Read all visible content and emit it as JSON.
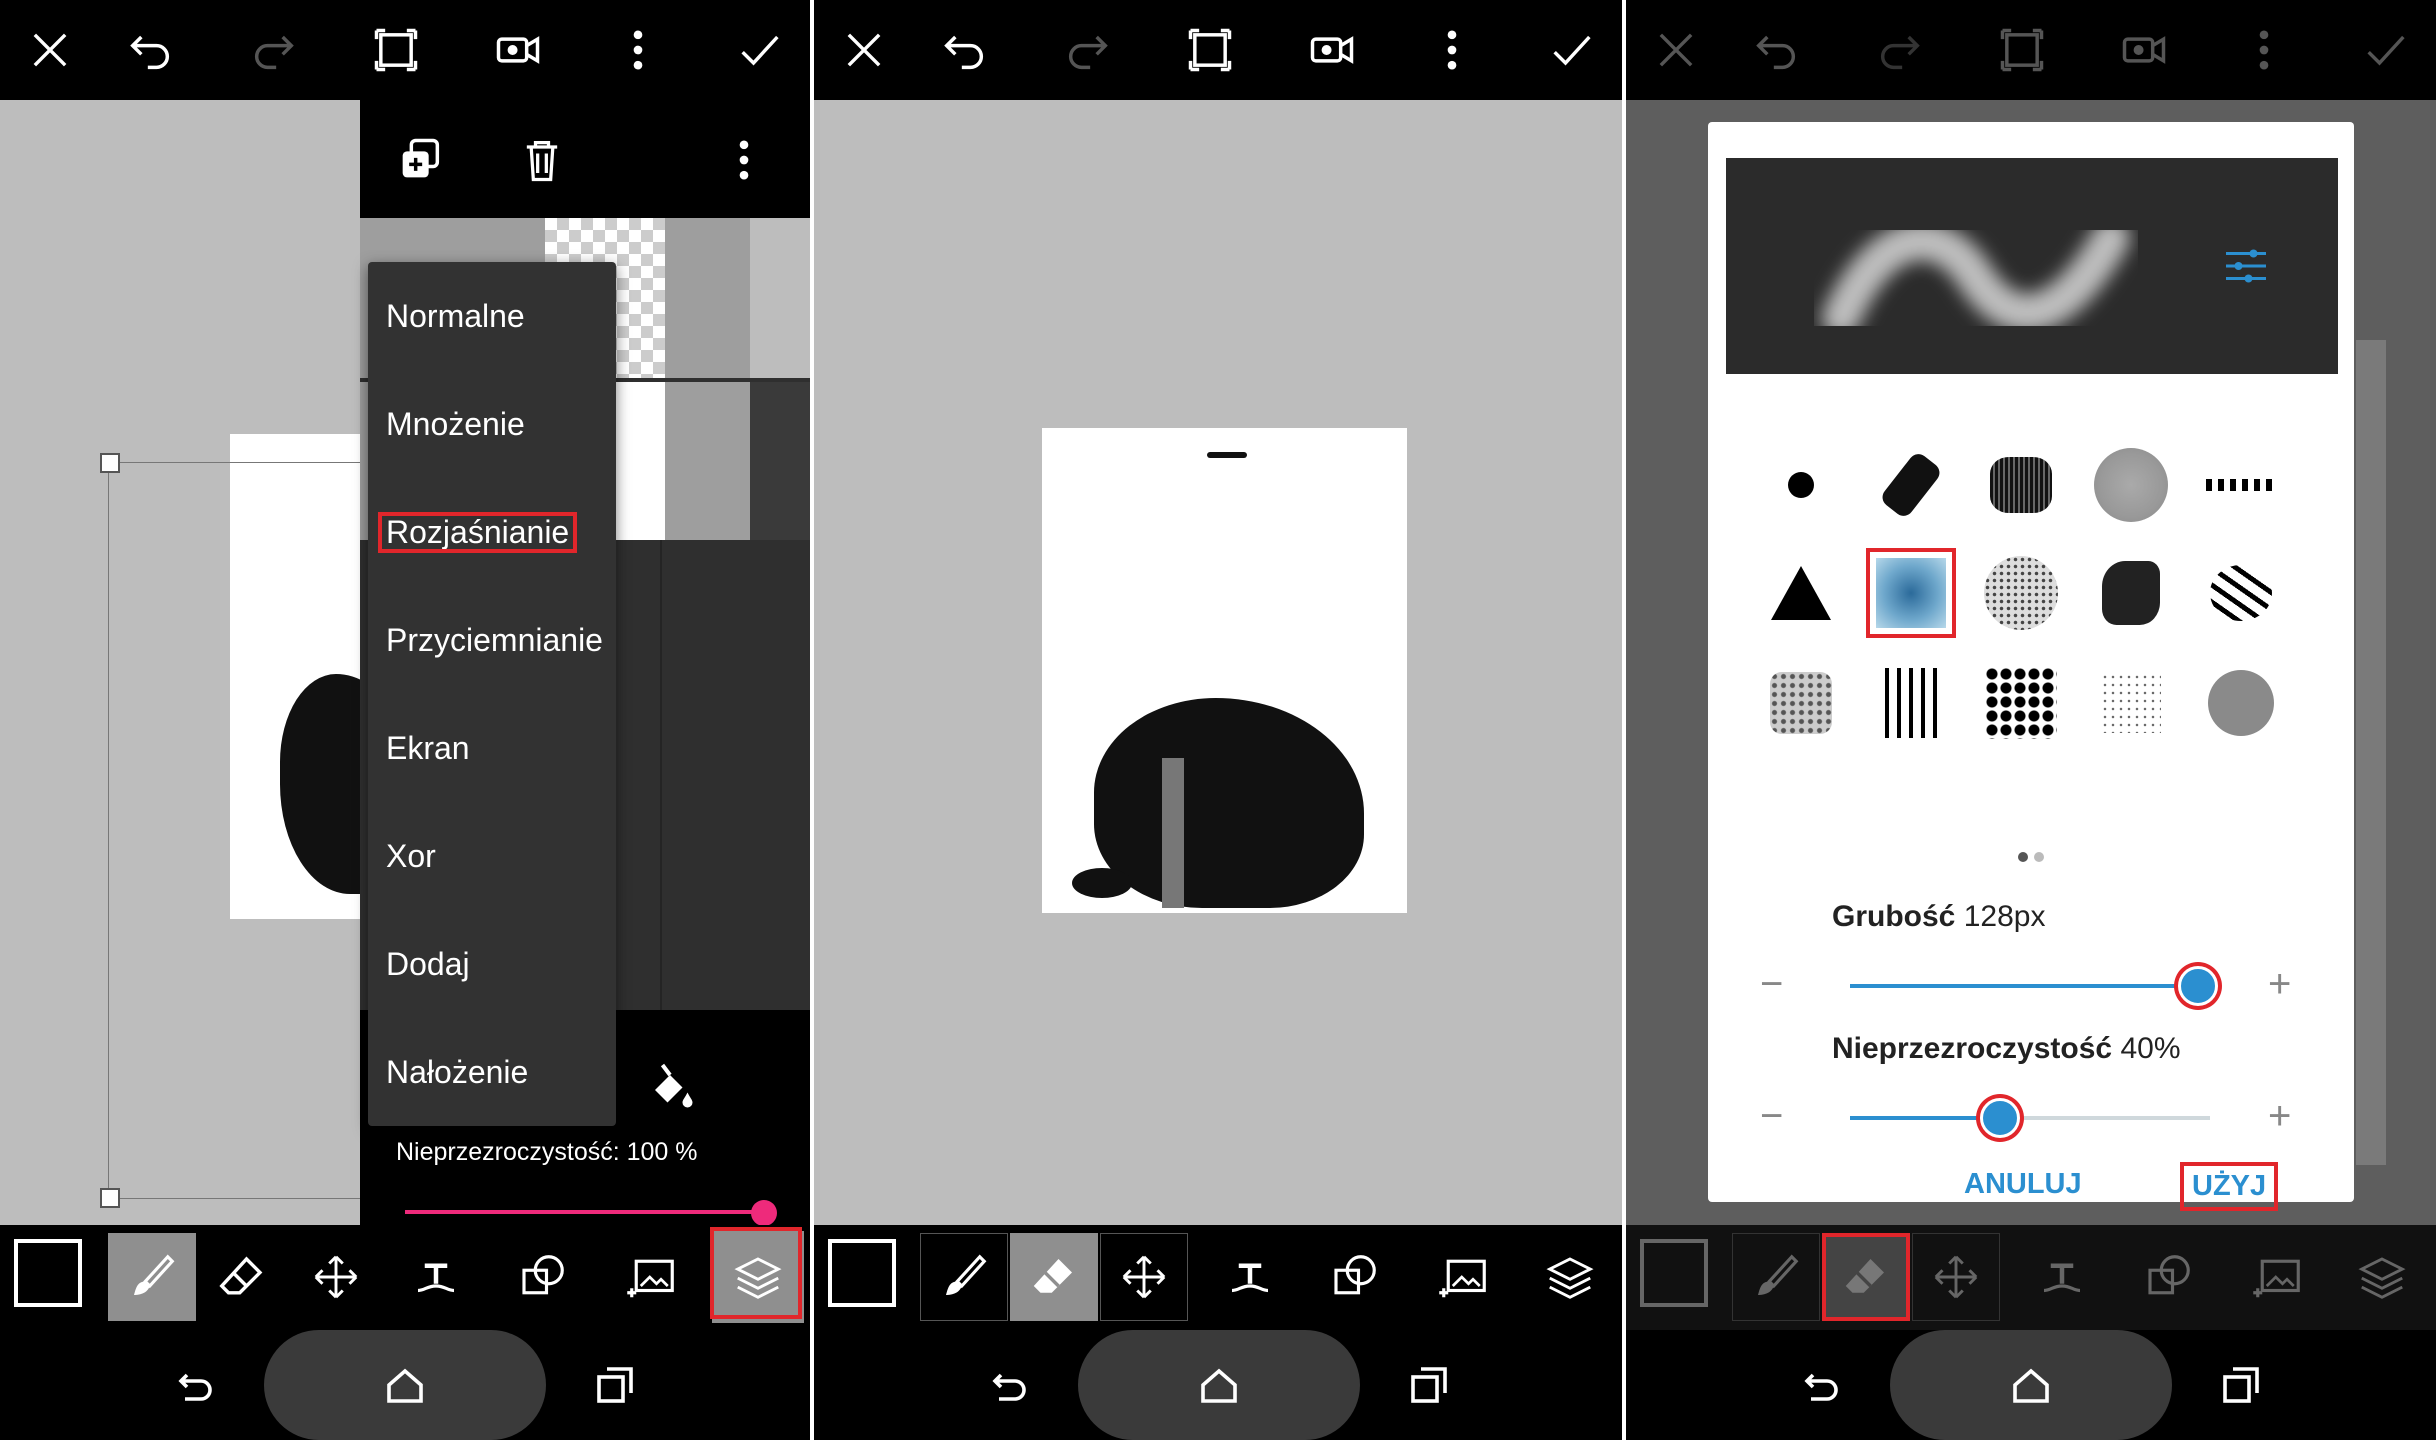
{
  "colors": {
    "accent_pink": "#ee2a7b",
    "accent_blue": "#2b8fd0",
    "highlight_red": "#e1262b"
  },
  "top_bar_icons": [
    "close-icon",
    "undo-icon",
    "redo-icon",
    "crop-frame-icon",
    "video-record-icon",
    "more-vert-icon",
    "check-icon"
  ],
  "bottom_tools": [
    "color-swatch",
    "brush-icon",
    "eraser-icon",
    "move-icon",
    "text-icon",
    "shape-icon",
    "image-add-icon",
    "layers-icon"
  ],
  "nav_icons": [
    "back-icon",
    "home-icon",
    "recent-apps-icon"
  ],
  "panel1": {
    "layer_toolbar_icons": [
      "duplicate-layer-icon",
      "delete-icon",
      "more-vert-icon"
    ],
    "blend_menu": {
      "items": [
        "Normalne",
        "Mnożenie",
        "Rozjaśnianie",
        "Przyciemnianie",
        "Ekran",
        "Xor",
        "Dodaj",
        "Nałożenie"
      ],
      "selected": "Rozjaśnianie"
    },
    "opacity_label": "Nieprzezroczystość: 100 %",
    "opacity_value": 100,
    "active_tool": "layers"
  },
  "panel2": {
    "active_tool": "eraser"
  },
  "panel3": {
    "brush_dialog": {
      "pager_pages": 2,
      "pager_current": 1,
      "selected_brush_index": 6,
      "thickness_label": "Grubość",
      "thickness_value": "128px",
      "thickness_level": 0.96,
      "opacity_label": "Nieprzezroczystość",
      "opacity_value": "40%",
      "opacity_level": 0.41,
      "minus": "−",
      "plus": "+",
      "cancel_label": "ANULUJ",
      "apply_label": "UŻYJ"
    },
    "active_tool": "eraser"
  }
}
